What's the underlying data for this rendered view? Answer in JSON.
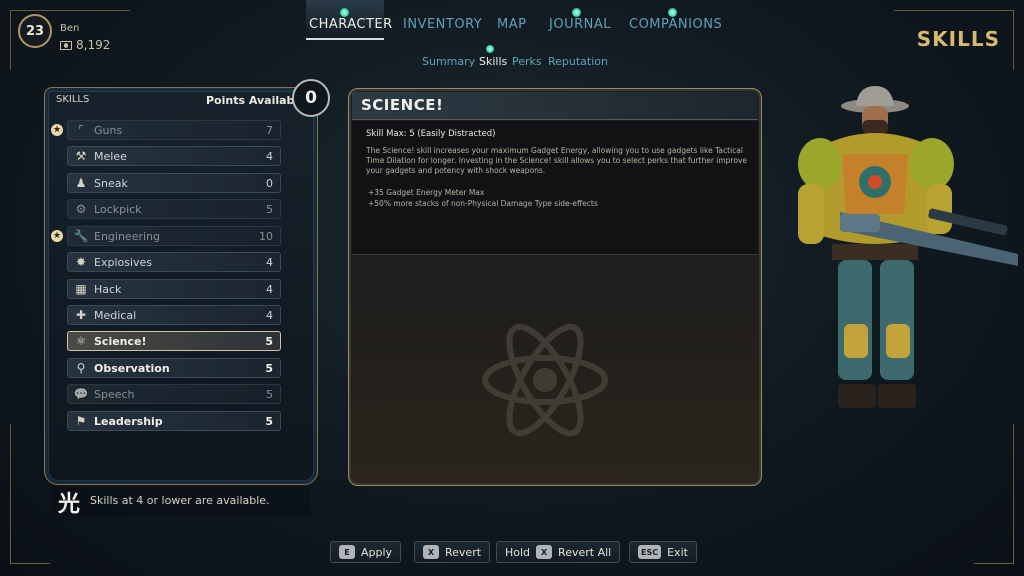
{
  "player": {
    "level": "23",
    "name": "Ben",
    "currency": "8,192",
    "currency_icon": "bit-icon"
  },
  "nav": {
    "tabs": [
      {
        "label": "CHARACTER",
        "active": true,
        "notification": true
      },
      {
        "label": "INVENTORY",
        "active": false,
        "notification": false
      },
      {
        "label": "MAP",
        "active": false,
        "notification": false
      },
      {
        "label": "JOURNAL",
        "active": false,
        "notification": true
      },
      {
        "label": "COMPANIONS",
        "active": false,
        "notification": true
      }
    ],
    "subtabs": [
      {
        "label": "Summary",
        "active": false
      },
      {
        "label": "Skills",
        "active": true,
        "notification": true
      },
      {
        "label": "Perks",
        "active": false
      },
      {
        "label": "Reputation",
        "active": false
      }
    ]
  },
  "page_title": "SKILLS",
  "skills_panel": {
    "header": "SKILLS",
    "points_label": "Points Available:",
    "points_value": "0",
    "skills": [
      {
        "name": "Guns",
        "value": "7",
        "favored": true,
        "available": false,
        "icon": "gun-icon"
      },
      {
        "name": "Melee",
        "value": "4",
        "favored": false,
        "available": true,
        "icon": "melee-icon"
      },
      {
        "name": "Sneak",
        "value": "0",
        "favored": false,
        "available": true,
        "icon": "sneak-icon"
      },
      {
        "name": "Lockpick",
        "value": "5",
        "favored": false,
        "available": false,
        "icon": "lockpick-icon"
      },
      {
        "name": "Engineering",
        "value": "10",
        "favored": true,
        "available": false,
        "icon": "wrench-icon"
      },
      {
        "name": "Explosives",
        "value": "4",
        "favored": false,
        "available": true,
        "icon": "explosives-icon"
      },
      {
        "name": "Hack",
        "value": "4",
        "favored": false,
        "available": true,
        "icon": "hack-icon"
      },
      {
        "name": "Medical",
        "value": "4",
        "favored": false,
        "available": true,
        "icon": "medical-icon"
      },
      {
        "name": "Science!",
        "value": "5",
        "favored": false,
        "available": false,
        "selected": true,
        "icon": "science-icon"
      },
      {
        "name": "Observation",
        "value": "5",
        "favored": false,
        "available": false,
        "icon": "observation-icon"
      },
      {
        "name": "Speech",
        "value": "5",
        "favored": false,
        "available": false,
        "icon": "speech-icon"
      },
      {
        "name": "Leadership",
        "value": "5",
        "favored": false,
        "available": false,
        "icon": "leadership-icon"
      }
    ],
    "footnote_glyph": "光",
    "footnote": "Skills at 4 or lower are available."
  },
  "detail": {
    "title": "SCIENCE!",
    "skill_max": "Skill Max: 5 (Easily Distracted)",
    "description": "The Science! skill increases your maximum Gadget Energy, allowing you to use gadgets like Tactical Time Dilation for longer. Investing in the Science! skill allows you to select perks that further improve your gadgets and potency with shock weapons.",
    "bonuses": [
      "+35 Gadget Energy Meter Max",
      "+50% more stacks of non-Physical Damage Type side-effects"
    ],
    "watermark_icon": "atom-icon"
  },
  "buttons": [
    {
      "key": "E",
      "label": "Apply"
    },
    {
      "key": "X",
      "label": "Revert"
    },
    {
      "prefix": "Hold",
      "key": "X",
      "label": "Revert All"
    },
    {
      "key": "ESC",
      "label": "Exit"
    }
  ],
  "colors": {
    "accent_gold": "#d9b970",
    "nav_teal": "#5da3b5",
    "notification_green": "#3ad6a6",
    "frame_gold": "#8a7446"
  }
}
